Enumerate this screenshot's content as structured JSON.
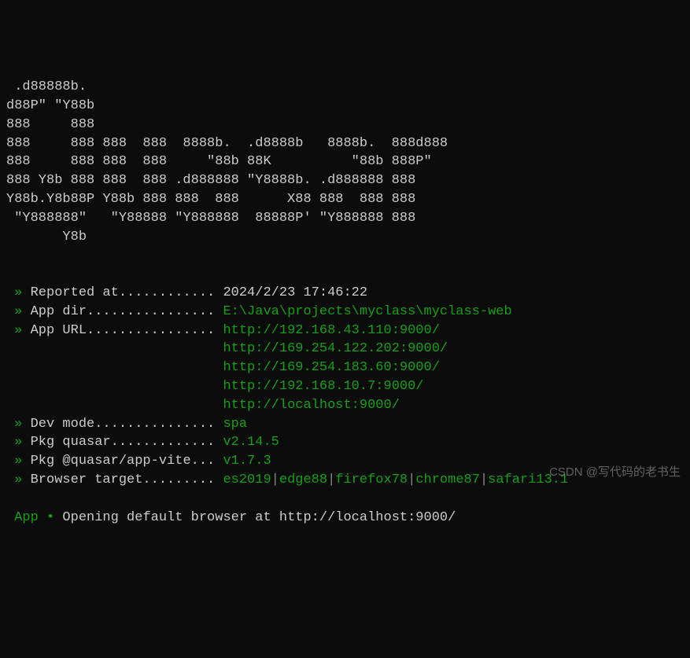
{
  "ascii": {
    "l1": " .d88888b.",
    "l2": "d88P\" \"Y88b",
    "l3": "888     888",
    "l4": "888     888 888  888  8888b.  .d8888b   8888b.  888d888",
    "l5": "888     888 888  888     \"88b 88K          \"88b 888P\"",
    "l6": "888 Y8b 888 888  888 .d888888 \"Y8888b. .d888888 888",
    "l7": "Y88b.Y8b88P Y88b 888 888  888      X88 888  888 888",
    "l8": " \"Y888888\"   \"Y88888 \"Y888888  88888P' \"Y888888 888",
    "l9": "       Y8b"
  },
  "info": {
    "reported_label": "Reported at............",
    "reported_value": "2024/2/23 17:46:22",
    "app_dir_label": "App dir................",
    "app_dir_value": "E:\\Java\\projects\\myclass\\myclass-web",
    "app_url_label": "App URL................",
    "urls": {
      "u1": "http://192.168.43.110:9000/",
      "u2": "http://169.254.122.202:9000/",
      "u3": "http://169.254.183.60:9000/",
      "u4": "http://192.168.10.7:9000/",
      "u5": "http://localhost:9000/"
    },
    "dev_mode_label": "Dev mode...............",
    "dev_mode_value": "spa",
    "pkg_quasar_label": "Pkg quasar.............",
    "pkg_quasar_value": "v2.14.5",
    "pkg_app_vite_label": "Pkg @quasar/app-vite...",
    "pkg_app_vite_value": "v1.7.3",
    "browser_target_label": "Browser target.........",
    "browser_targets": {
      "t1": "es2019",
      "t2": "edge88",
      "t3": "firefox78",
      "t4": "chrome87",
      "t5": "safari13.1"
    }
  },
  "status": {
    "app_label": "App",
    "bullet": "•",
    "message": "Opening default browser at http://localhost:9000/"
  },
  "watermark": "CSDN @写代码的老书生",
  "glyphs": {
    "arrow": " » ",
    "pipe": "|"
  }
}
